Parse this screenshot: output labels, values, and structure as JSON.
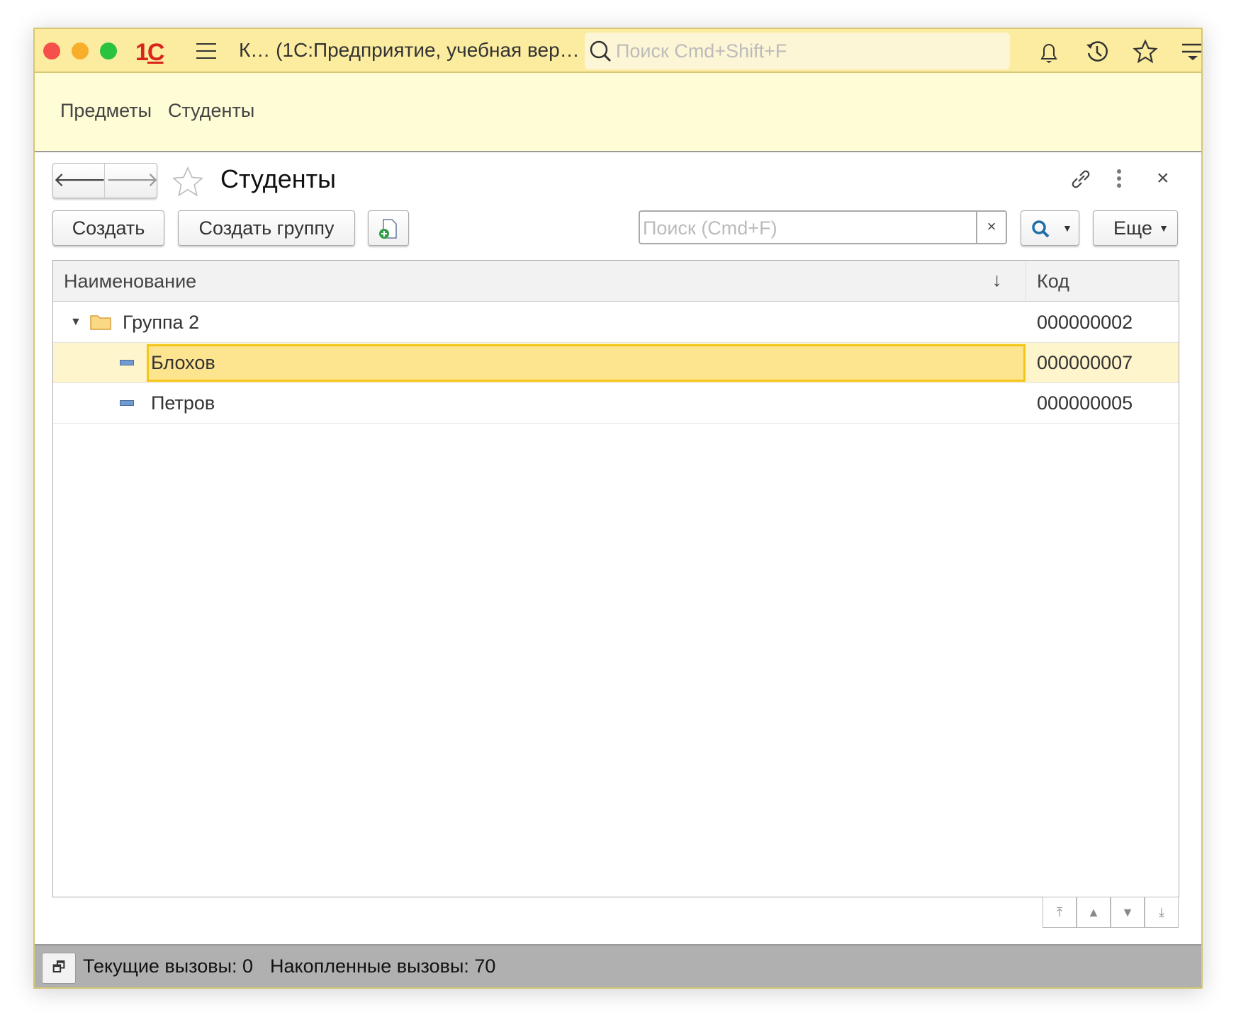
{
  "titlebar": {
    "logo": "1С",
    "title": "К… (1С:Предприятие, учебная вер…",
    "search_placeholder": "Поиск Cmd+Shift+F"
  },
  "sections": [
    "Предметы",
    "Студенты"
  ],
  "form": {
    "title": "Студенты",
    "create": "Создать",
    "create_group": "Создать группу",
    "search_placeholder": "Поиск (Cmd+F)",
    "clear": "×",
    "more": "Еще"
  },
  "table": {
    "columns": [
      "Наименование",
      "Код"
    ],
    "sort_indicator": "↓",
    "rows": [
      {
        "name": "Группа 2",
        "code": "000000002",
        "type": "group"
      },
      {
        "name": "Блохов",
        "code": "000000007",
        "type": "item",
        "selected": true
      },
      {
        "name": "Петров",
        "code": "000000005",
        "type": "item"
      }
    ]
  },
  "status": {
    "current": "Текущие вызовы: 0",
    "accumulated": "Накопленные вызовы: 70"
  },
  "colors": {
    "titlebar": "#fbeca0",
    "sections": "#fffdd5",
    "selection": "#fde48f",
    "selection_border": "#f5c518"
  }
}
